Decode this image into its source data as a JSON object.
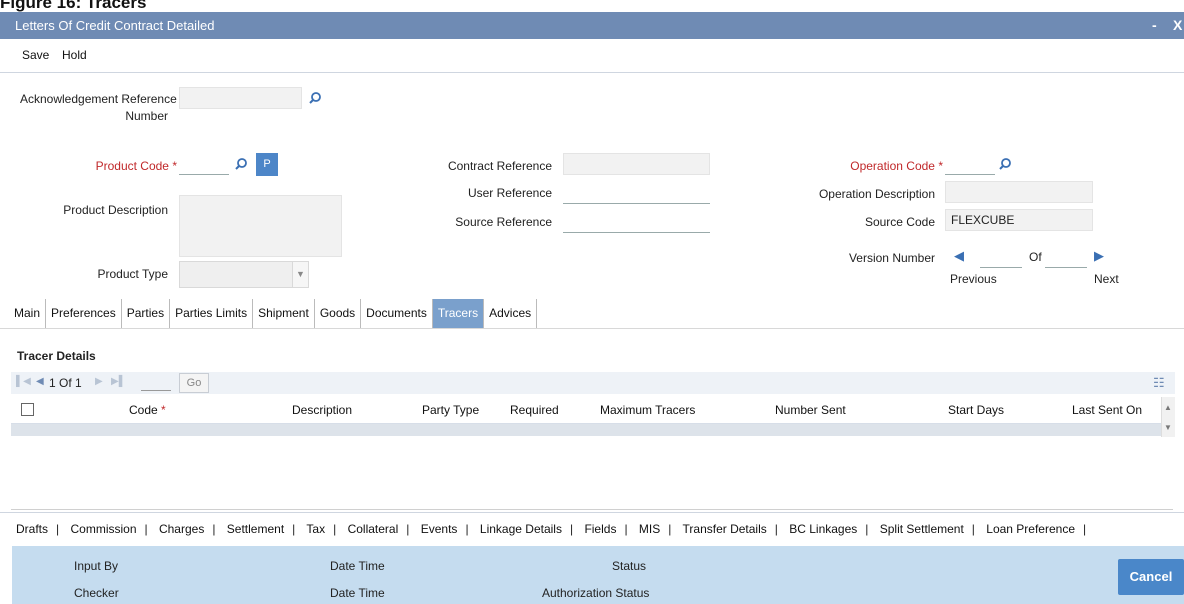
{
  "caption": "Figure 16: Tracers",
  "window": {
    "title": "Letters Of Credit Contract Detailed",
    "minimize": "-",
    "close": "X"
  },
  "menu": {
    "save": "Save",
    "hold": "Hold"
  },
  "form": {
    "ack_ref_line1": "Acknowledgement Reference",
    "ack_ref_line2": "Number",
    "product_code": "Product Code",
    "product_code_button": "P",
    "product_description": "Product Description",
    "product_type": "Product Type",
    "contract_reference": "Contract Reference",
    "user_reference": "User Reference",
    "source_reference": "Source Reference",
    "operation_code": "Operation Code",
    "operation_description": "Operation Description",
    "source_code": "Source Code",
    "source_code_value": "FLEXCUBE",
    "version_number": "Version Number",
    "of": "Of",
    "previous": "Previous",
    "next": "Next",
    "required_marker": "*"
  },
  "tabs": [
    "Main",
    "Preferences",
    "Parties",
    "Parties Limits",
    "Shipment",
    "Goods",
    "Documents",
    "Tracers",
    "Advices"
  ],
  "active_tab": "Tracers",
  "tracer": {
    "title": "Tracer Details",
    "page_text": "1 Of 1",
    "go": "Go",
    "columns": [
      "Code",
      "Description",
      "Party Type",
      "Required",
      "Maximum Tracers",
      "Number Sent",
      "Start Days",
      "Last Sent On"
    ]
  },
  "bottom_links": [
    "Drafts",
    "Commission",
    "Charges",
    "Settlement",
    "Tax",
    "Collateral",
    "Events",
    "Linkage Details",
    "Fields",
    "MIS",
    "Transfer Details",
    "BC Linkages",
    "Split Settlement",
    "Loan Preference"
  ],
  "footer": {
    "input_by": "Input By",
    "checker": "Checker",
    "date_time": "Date Time",
    "date_time2": "Date Time",
    "status": "Status",
    "authorization_status": "Authorization Status",
    "cancel": "Cancel"
  },
  "colors": {
    "titlebar": "#6f8bb4",
    "accent": "#4a87c9",
    "required": "#c0282a",
    "footer": "#c5dcef"
  }
}
